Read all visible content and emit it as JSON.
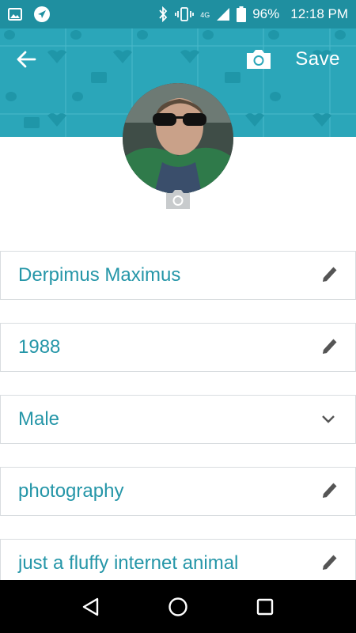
{
  "status_bar": {
    "battery_percent": "96%",
    "time": "12:18 PM",
    "network": "4G"
  },
  "toolbar": {
    "save_label": "Save"
  },
  "profile": {
    "fields": [
      {
        "value": "Derpimus Maximus",
        "icon": "pencil-icon"
      },
      {
        "value": "1988",
        "icon": "pencil-icon"
      },
      {
        "value": "Male",
        "icon": "chevron-down-icon"
      },
      {
        "value": "photography",
        "icon": "pencil-icon"
      },
      {
        "value": "just a fluffy internet animal",
        "icon": "pencil-icon"
      }
    ]
  },
  "colors": {
    "status_bar": "#1f8fa0",
    "header": "#2ba6b9",
    "accent_text": "#2596a8",
    "field_border": "#d9dde0"
  }
}
